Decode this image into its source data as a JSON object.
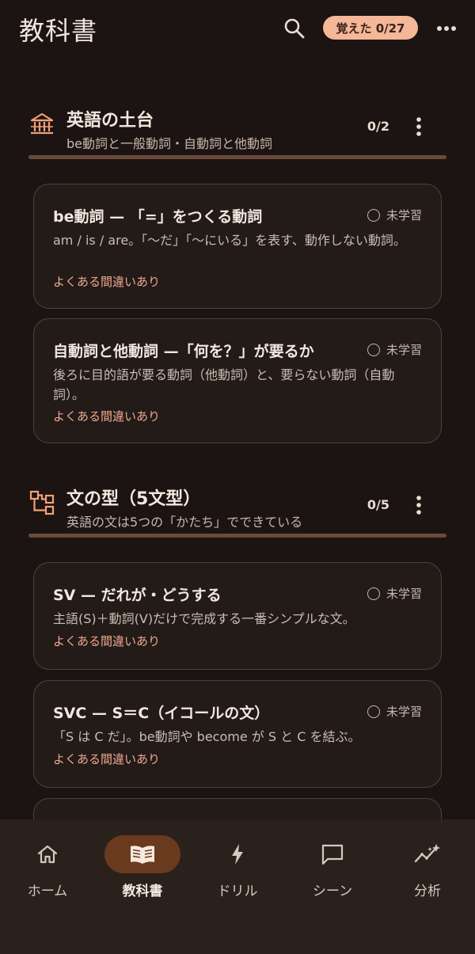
{
  "header": {
    "title": "教科書",
    "progress_label": "覚えた 0/27",
    "search_icon": "search-icon",
    "more_icon": "more-horizontal-icon"
  },
  "sections": [
    {
      "title": "英語の土台",
      "subtitle": "be動詞と一般動詞・自動詞と他動詞",
      "count": "0/2",
      "icon": "foundation-icon",
      "cards": [
        {
          "title": "be動詞 — 「=」をつくる動詞",
          "status": "未学習",
          "description": "am / is / are。「〜だ」「〜にいる」を表す、動作しない動詞。",
          "warning": "よくある間違いあり"
        },
        {
          "title": "自動詞と他動詞 —「何を？」が要るか",
          "status": "未学習",
          "description": "後ろに目的語が要る動詞（他動詞）と、要らない動詞（自動詞）。",
          "warning": "よくある間違いあり"
        }
      ]
    },
    {
      "title": "文の型（5文型）",
      "subtitle": "英語の文は5つの「かたち」でできている",
      "count": "0/5",
      "icon": "structure-tree-icon",
      "cards": [
        {
          "title": "SV — だれが・どうする",
          "status": "未学習",
          "description": "主語(S)＋動詞(V)だけで完成する一番シンプルな文。",
          "warning": "よくある間違いあり"
        },
        {
          "title": "SVC — S＝C（イコールの文）",
          "status": "未学習",
          "description": "「S は C だ」。be動詞や become が S と C を結ぶ。",
          "warning": "よくある間違いあり"
        }
      ]
    }
  ],
  "nav": {
    "items": [
      {
        "label": "ホーム",
        "icon": "home-icon",
        "active": false
      },
      {
        "label": "教科書",
        "icon": "book-icon",
        "active": true
      },
      {
        "label": "ドリル",
        "icon": "bolt-icon",
        "active": false
      },
      {
        "label": "シーン",
        "icon": "chat-icon",
        "active": false
      },
      {
        "label": "分析",
        "icon": "analytics-icon",
        "active": false
      }
    ]
  },
  "colors": {
    "background": "#1b1412",
    "accent": "#f4b797",
    "warning_text": "#f0a890",
    "nav_active": "#6a3a1e"
  }
}
